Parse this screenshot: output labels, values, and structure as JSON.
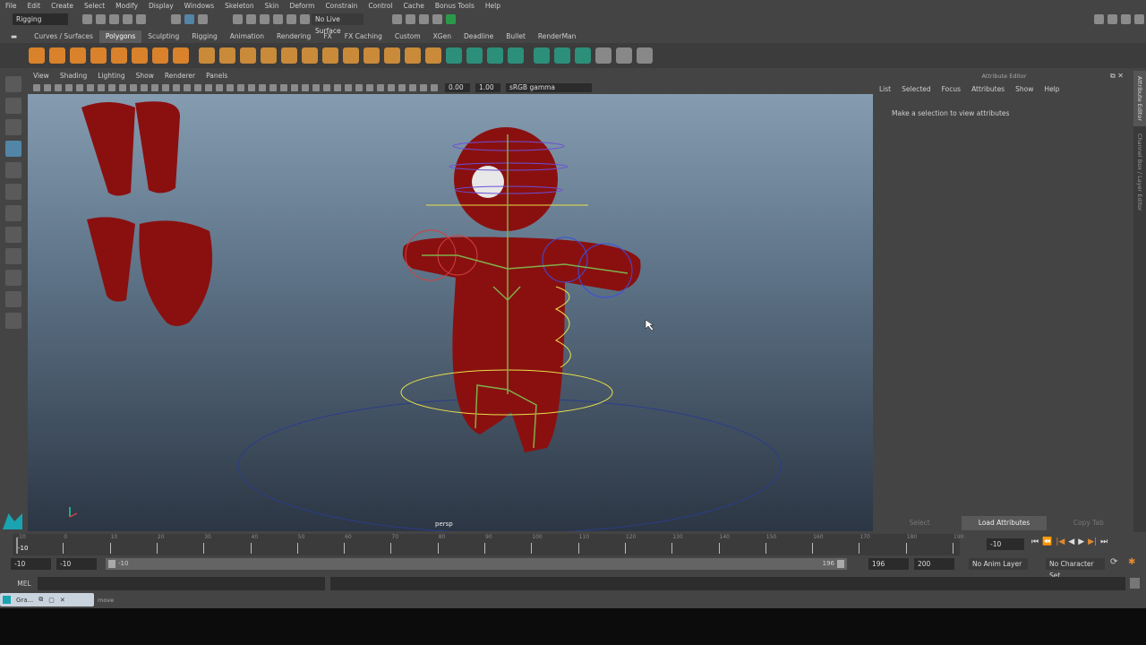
{
  "menubar": [
    "File",
    "Edit",
    "Create",
    "Select",
    "Modify",
    "Display",
    "Windows",
    "Skeleton",
    "Skin",
    "Deform",
    "Constrain",
    "Control",
    "Cache",
    "Bonus Tools",
    "Help"
  ],
  "status": {
    "menuset": "Rigging",
    "live_surface": "No Live Surface"
  },
  "shelf_tabs": [
    "Curves / Surfaces",
    "Polygons",
    "Sculpting",
    "Rigging",
    "Animation",
    "Rendering",
    "FX",
    "FX Caching",
    "Custom",
    "XGen",
    "Deadline",
    "Bullet",
    "RenderMan"
  ],
  "shelf_active": "Polygons",
  "viewport": {
    "menu": [
      "View",
      "Shading",
      "Lighting",
      "Show",
      "Renderer",
      "Panels"
    ],
    "exposure": "0.00",
    "gamma": "1.00",
    "color_space": "sRGB gamma",
    "camera_label": "persp"
  },
  "attribute_editor": {
    "title": "Attribute Editor",
    "menu": [
      "List",
      "Selected",
      "Focus",
      "Attributes",
      "Show",
      "Help"
    ],
    "message": "Make a selection to view attributes",
    "buttons": {
      "select": "Select",
      "load": "Load Attributes",
      "copy": "Copy Tab"
    }
  },
  "side_tabs": {
    "attr": "Attribute Editor",
    "channel": "Channel Box / Layer Editor"
  },
  "timeline": {
    "ticks": [
      -10,
      0,
      10,
      20,
      30,
      40,
      50,
      60,
      70,
      80,
      90,
      100,
      110,
      120,
      130,
      140,
      150,
      160,
      170,
      180,
      190
    ],
    "current_frame": "-10",
    "current_field": "-10"
  },
  "range": {
    "start": "-10",
    "anim_start": "-10",
    "slider_start": "-10",
    "slider_end": "196",
    "anim_end": "196",
    "end": "200",
    "anim_layer": "No Anim Layer",
    "character_set": "No Character Set"
  },
  "command": {
    "label": "MEL"
  },
  "taskbar": {
    "window": "Gra...",
    "help_line": "move"
  },
  "colors": {
    "accent": "#5285a6",
    "mesh": "#8a1010",
    "orange": "#e38a2a"
  }
}
